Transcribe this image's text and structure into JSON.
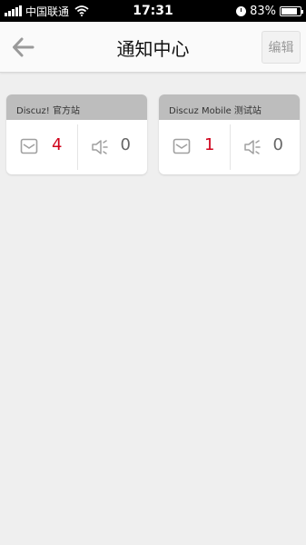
{
  "status_bar": {
    "carrier": "中国联通",
    "time": "17:31",
    "battery_percent": "83%",
    "battery_level": 0.83
  },
  "nav": {
    "title": "通知中心",
    "edit_label": "编辑"
  },
  "sites": [
    {
      "name": "Discuz! 官方站",
      "message_count": "4",
      "notice_count": "0"
    },
    {
      "name": "Discuz Mobile 测试站",
      "message_count": "1",
      "notice_count": "0"
    }
  ],
  "colors": {
    "accent_count": "#d0021b",
    "card_header": "#bdbdbd",
    "background": "#efefef"
  },
  "icons": {
    "back": "arrow-left-icon",
    "message": "envelope-icon",
    "notice": "speaker-icon"
  }
}
